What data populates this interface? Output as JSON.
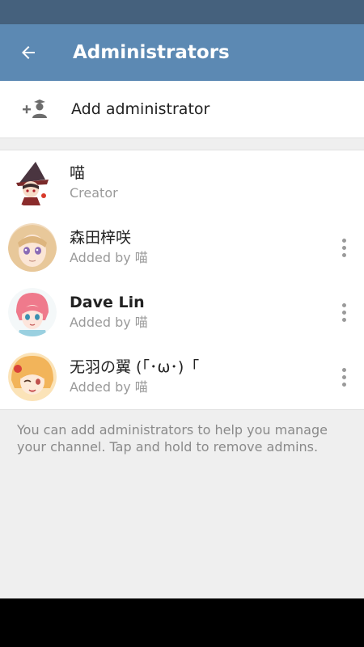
{
  "header": {
    "title": "Administrators",
    "back_icon": "arrow-left-icon"
  },
  "add_admin": {
    "label": "Add administrator",
    "icon": "add-admin-icon"
  },
  "admins": [
    {
      "name": "喵",
      "subtitle": "Creator",
      "has_menu": false,
      "bold": false
    },
    {
      "name": "森田梓咲",
      "subtitle": "Added by 喵",
      "has_menu": true,
      "bold": false
    },
    {
      "name": "Dave Lin",
      "subtitle": "Added by 喵",
      "has_menu": true,
      "bold": true
    },
    {
      "name": "无羽の翼 (「･ω･)「",
      "subtitle": "Added by 喵",
      "has_menu": true,
      "bold": false
    }
  ],
  "hint": "You can add administrators to help you manage your channel. Tap and hold to remove admins.",
  "colors": {
    "status_bar": "#45617d",
    "app_bar": "#5c89b3",
    "subtitle": "#9a9a9a"
  }
}
